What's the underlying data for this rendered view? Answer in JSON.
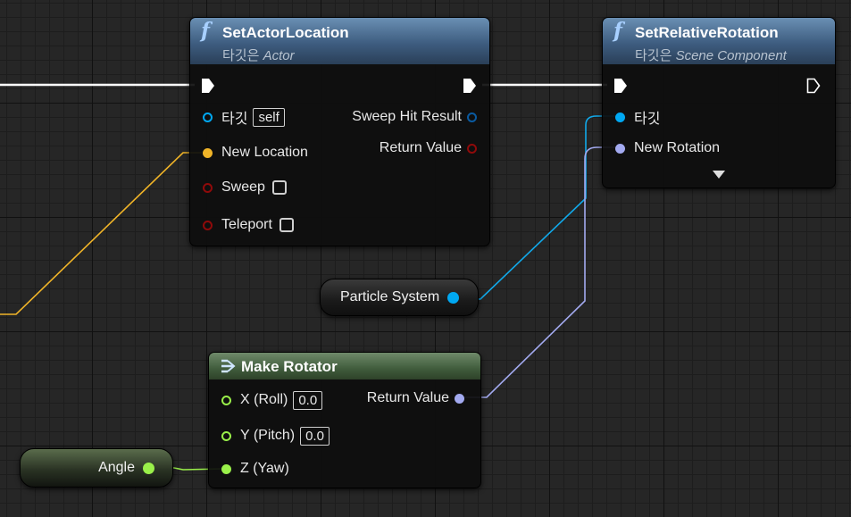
{
  "nodes": {
    "set_actor_location": {
      "title": "SetActorLocation",
      "target_prefix": "타깃은",
      "target_class": "Actor",
      "inputs": {
        "target": "타깃",
        "target_default": "self",
        "new_location": "New Location",
        "sweep": "Sweep",
        "teleport": "Teleport"
      },
      "outputs": {
        "sweep_hit_result": "Sweep Hit Result",
        "return_value": "Return Value"
      }
    },
    "set_relative_rotation": {
      "title": "SetRelativeRotation",
      "target_prefix": "타깃은",
      "target_class": "Scene Component",
      "inputs": {
        "target": "타깃",
        "new_rotation": "New Rotation"
      },
      "expand_icon": "chevron-down-icon"
    },
    "make_rotator": {
      "title": "Make Rotator",
      "inputs": {
        "x": "X (Roll)",
        "x_value": "0.0",
        "y": "Y (Pitch)",
        "y_value": "0.0",
        "z": "Z (Yaw)"
      },
      "outputs": {
        "return_value": "Return Value"
      }
    },
    "particle_system": {
      "label": "Particle System"
    },
    "angle": {
      "label": "Angle"
    }
  },
  "colors": {
    "object_pin": "#00a8f2",
    "vector_pin": "#f0b428",
    "bool_pin": "#8f0a0a",
    "rotator_pin": "#a3aaf0",
    "float_pin": "#9af04a",
    "exec": "#ffffff",
    "function_header": "#3e5d80",
    "pure_header": "#405c3c"
  }
}
